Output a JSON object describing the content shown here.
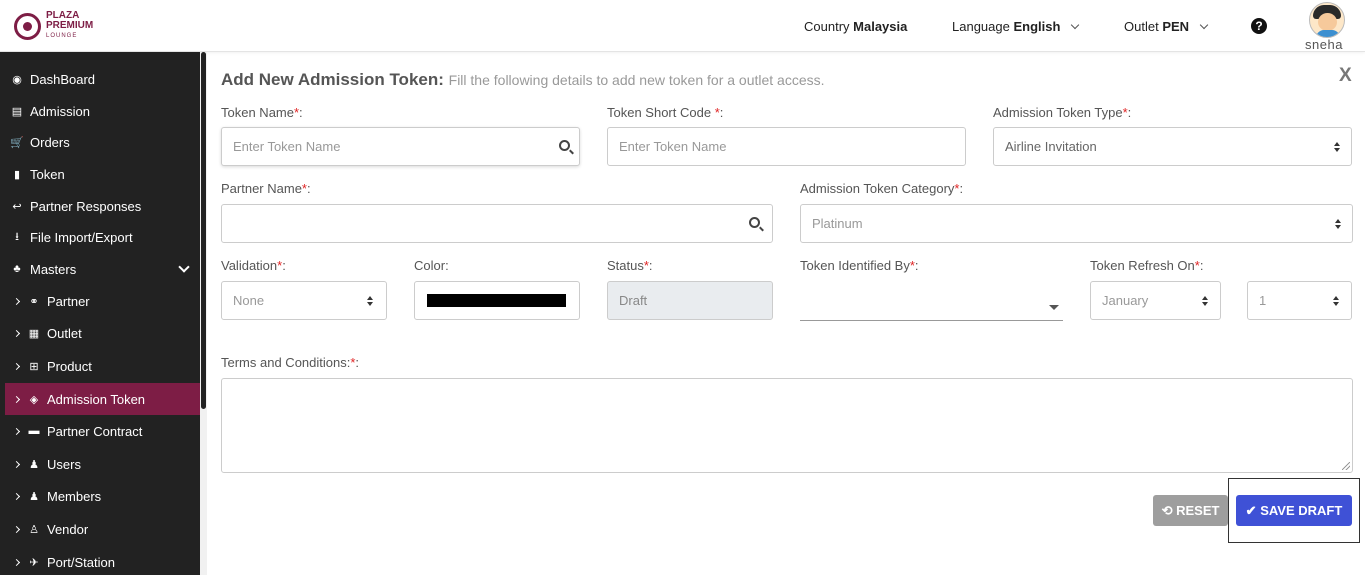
{
  "header": {
    "logo": {
      "line1": "PLAZA",
      "line2": "PREMIUM",
      "line3": "LOUNGE"
    },
    "country": {
      "label": "Country",
      "value": "Malaysia"
    },
    "language": {
      "label": "Language",
      "value": "English"
    },
    "outlet": {
      "label": "Outlet",
      "value": "PEN"
    },
    "help": "?",
    "username": "sneha"
  },
  "sidebar": {
    "items": [
      {
        "label": "DashBoard",
        "icon": "dashboard-icon",
        "glyph": "◉"
      },
      {
        "label": "Admission",
        "icon": "id-card-icon",
        "glyph": "▤"
      },
      {
        "label": "Orders",
        "icon": "cart-icon",
        "glyph": "🛒"
      },
      {
        "label": "Token",
        "icon": "file-icon",
        "glyph": "▮"
      },
      {
        "label": "Partner Responses",
        "icon": "reply-icon",
        "glyph": "↩"
      },
      {
        "label": "File Import/Export",
        "icon": "download-icon",
        "glyph": "⭳"
      },
      {
        "label": "Masters",
        "icon": "sitemap-icon",
        "glyph": "♣"
      }
    ],
    "sub_items": [
      {
        "label": "Partner",
        "icon": "handshake-icon",
        "glyph": "⚭"
      },
      {
        "label": "Outlet",
        "icon": "building-icon",
        "glyph": "▦"
      },
      {
        "label": "Product",
        "icon": "gift-icon",
        "glyph": "⊞"
      },
      {
        "label": "Admission Token",
        "icon": "tag-icon",
        "glyph": "◈"
      },
      {
        "label": "Partner Contract",
        "icon": "briefcase-icon",
        "glyph": "▬"
      },
      {
        "label": "Users",
        "icon": "user-icon",
        "glyph": "♟"
      },
      {
        "label": "Members",
        "icon": "users-icon",
        "glyph": "♟"
      },
      {
        "label": "Vendor",
        "icon": "person-icon",
        "glyph": "♙"
      },
      {
        "label": "Port/Station",
        "icon": "plane-icon",
        "glyph": "✈"
      }
    ]
  },
  "form": {
    "title": "Add New Admission Token:",
    "subtitle": "Fill the following details to add new token for a outlet access.",
    "close": "X",
    "token_name": {
      "label": "Token Name",
      "placeholder": "Enter Token Name"
    },
    "token_short_code": {
      "label": "Token Short Code ",
      "placeholder": "Enter Token Name"
    },
    "admission_token_type": {
      "label": "Admission Token Type",
      "value": "Airline Invitation"
    },
    "partner_name": {
      "label": "Partner Name",
      "value": ""
    },
    "admission_token_category": {
      "label": "Admission Token Category",
      "value": "Platinum"
    },
    "validation": {
      "label": "Validation",
      "value": "None"
    },
    "color": {
      "label": "Color:",
      "value": "#000000"
    },
    "status": {
      "label": "Status",
      "value": "Draft"
    },
    "token_identified_by": {
      "label": "Token Identified By",
      "value": ""
    },
    "token_refresh_on": {
      "label": "Token Refresh On",
      "month": "January",
      "day": "1"
    },
    "terms": {
      "label": "Terms and Conditions:",
      "value": ""
    },
    "required_mark": "*",
    "colon": ":",
    "reset_label": "RESET",
    "save_label": "SAVE DRAFT"
  },
  "colors": {
    "brand": "#7d1d45",
    "primary_button": "#3f51d6",
    "reset_button": "#9e9e9e",
    "sidebar": "#222222"
  }
}
